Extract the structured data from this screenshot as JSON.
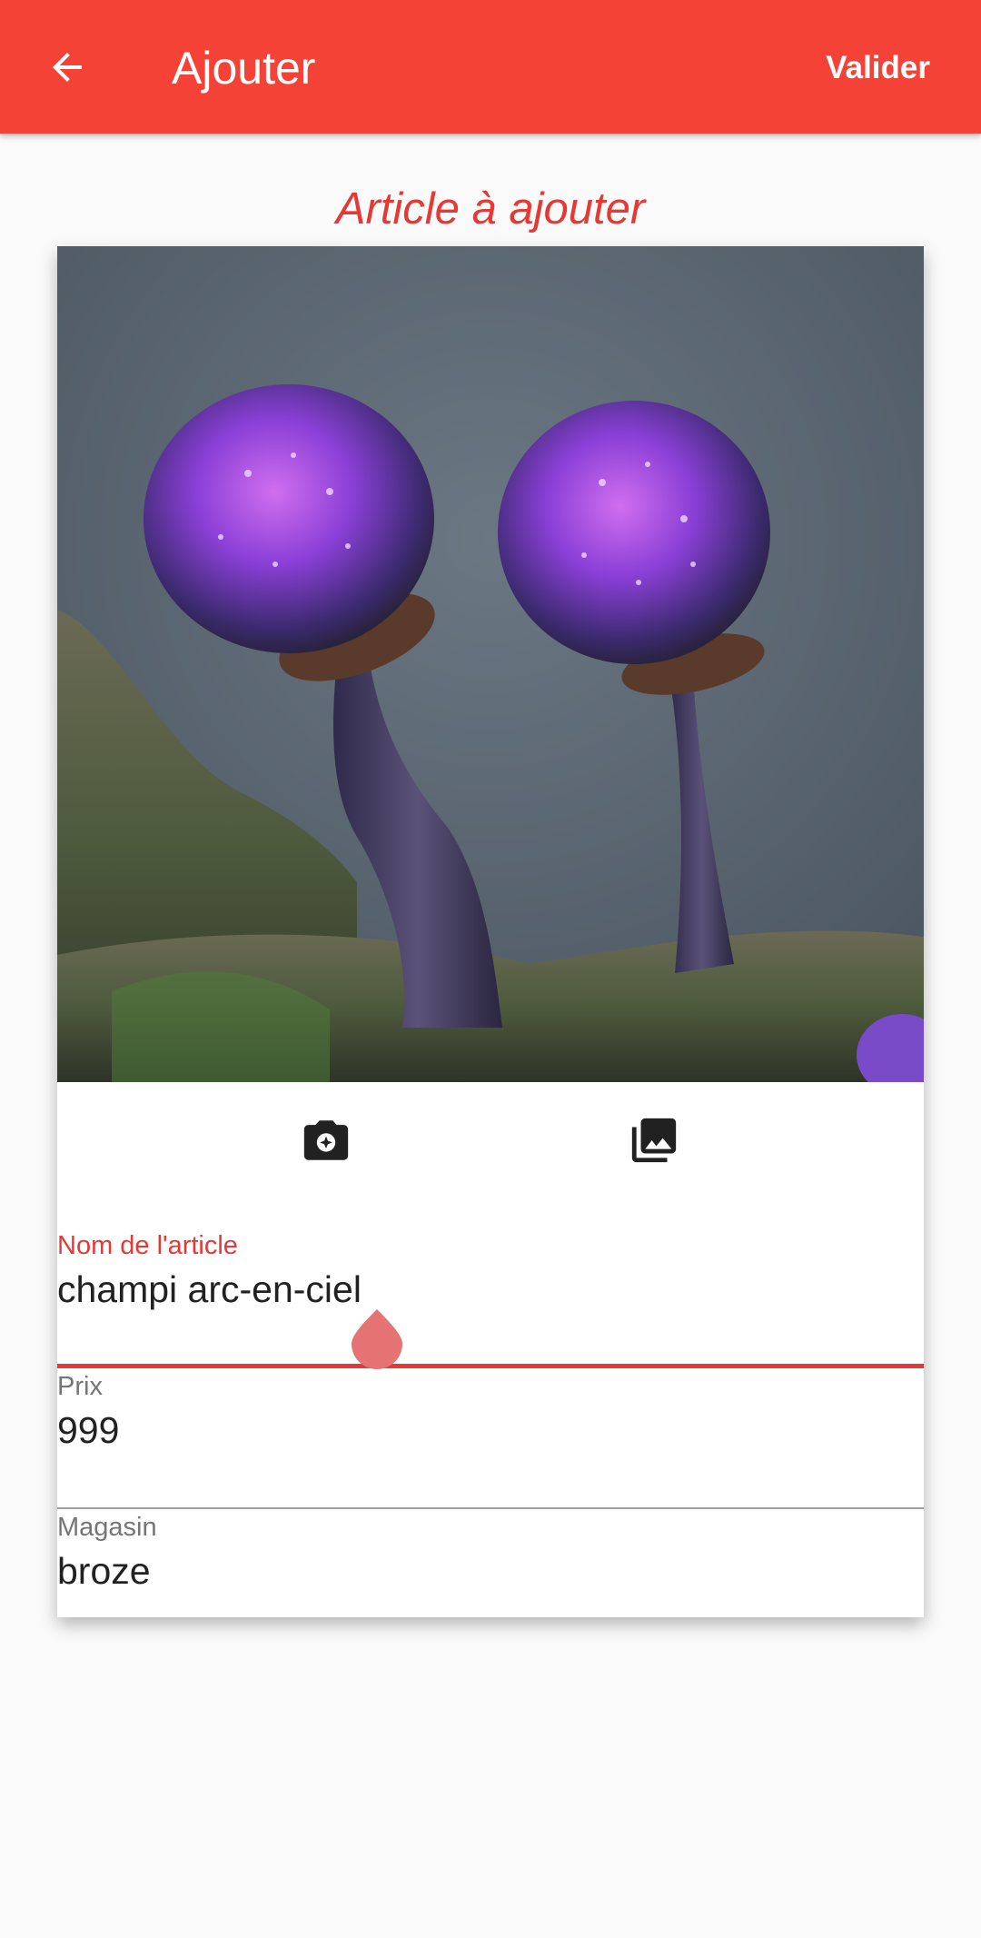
{
  "appbar": {
    "title": "Ajouter",
    "back_icon": "arrow-back-icon",
    "action_label": "Valider",
    "color": "#f44336"
  },
  "section_title": "Article à ajouter",
  "image": {
    "subject": "photo"
  },
  "photo_actions": {
    "camera_icon": "camera-icon",
    "gallery_icon": "photo-library-icon"
  },
  "fields": [
    {
      "label": "Nom de l'article",
      "value": "champi arc-en-ciel",
      "focused": true
    },
    {
      "label": "Prix",
      "value": "999",
      "focused": false
    },
    {
      "label": "Magasin",
      "value": "broze",
      "focused": false
    }
  ],
  "colors": {
    "accent": "#e53935",
    "background": "#fafafa"
  }
}
